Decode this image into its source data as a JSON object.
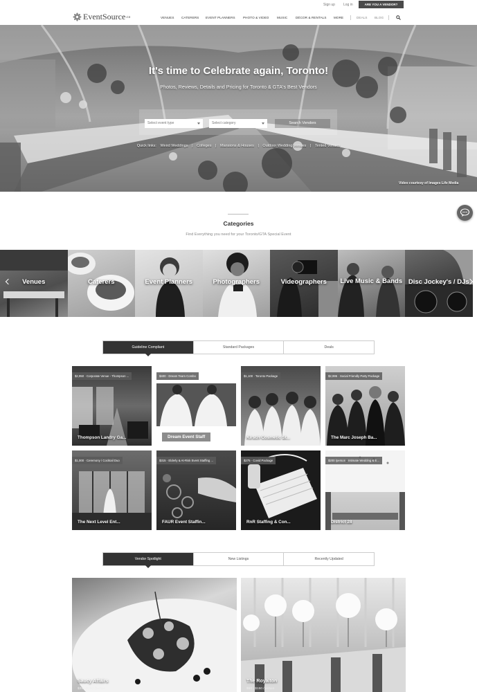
{
  "topbar": {
    "signup": "Sign up",
    "login": "Log in",
    "vendor_cta": "ARE YOU A VENDOR?"
  },
  "logo": {
    "name": "EventSource",
    "tld": ".ca"
  },
  "nav": {
    "items": [
      "VENUES",
      "CATERERS",
      "EVENT PLANNERS",
      "PHOTO & VIDEO",
      "MUSIC",
      "DÉCOR & RENTALS",
      "MORE"
    ],
    "secondary": [
      "DEALS",
      "BLOG"
    ]
  },
  "hero": {
    "title": "It's time to Celebrate again, Toronto!",
    "subtitle": "Photos, Reviews, Details and Pricing for Toronto & GTA's Best Vendors",
    "event_type_placeholder": "Select event type",
    "category_placeholder": "Select category",
    "search_button": "Search Vendors",
    "quicklinks": [
      "Quick links:",
      "Weird Weddings",
      "|",
      "Colleges",
      "|",
      "Mansions & Houses",
      "|",
      "Outdoor Wedding Venues",
      "|",
      "Tented Venues"
    ],
    "credit": "Video courtesy of Images Life Media"
  },
  "categories": {
    "title": "Categories",
    "subtitle": "Find Everything you need for your Toronto/GTA Special Event",
    "items": [
      "Venues",
      "Caterers",
      "Event Planners",
      "Photographers",
      "Videographers",
      "Live Music & Bands",
      "Disc Jockey's / DJs"
    ]
  },
  "package_tabs": [
    "Guideline Compliant",
    "Standard Packages",
    "Deals"
  ],
  "packages": [
    {
      "price": "$2,950 · Corporate Venue - Thompson ...",
      "name": "Thompson Landry Ga..."
    },
    {
      "price": "$400 · Dream Team Combo",
      "name": "Dream Event Staff"
    },
    {
      "price": "$1,100 · Toronto Package",
      "name": "Kirsch Cosmetic St..."
    },
    {
      "price": "$2,995 · Social Friendly Party Package",
      "name": "The Marc Joseph Ba..."
    },
    {
      "price": "$1,000 · Ceremony / Cocktail Duo",
      "name": "The Next Level Ent..."
    },
    {
      "price": "$315 · Elderly & At-Risk Event Staffing ...",
      "name": "FAUR Event Staffin..."
    },
    {
      "price": "$275 · Covid Package",
      "name": "RnR Staffing & Con..."
    },
    {
      "price": "$200 /person · Intimate Wedding & E...",
      "name": "District 28"
    }
  ],
  "spotlight_tabs": [
    "Vendor Spotlight",
    "New Listings",
    "Recently Updated"
  ],
  "spotlight": [
    {
      "name": "Saucy Affairs",
      "price": "$35 - $250 /person"
    },
    {
      "name": "The Royalton",
      "price": "$60 - $150 /person"
    }
  ]
}
